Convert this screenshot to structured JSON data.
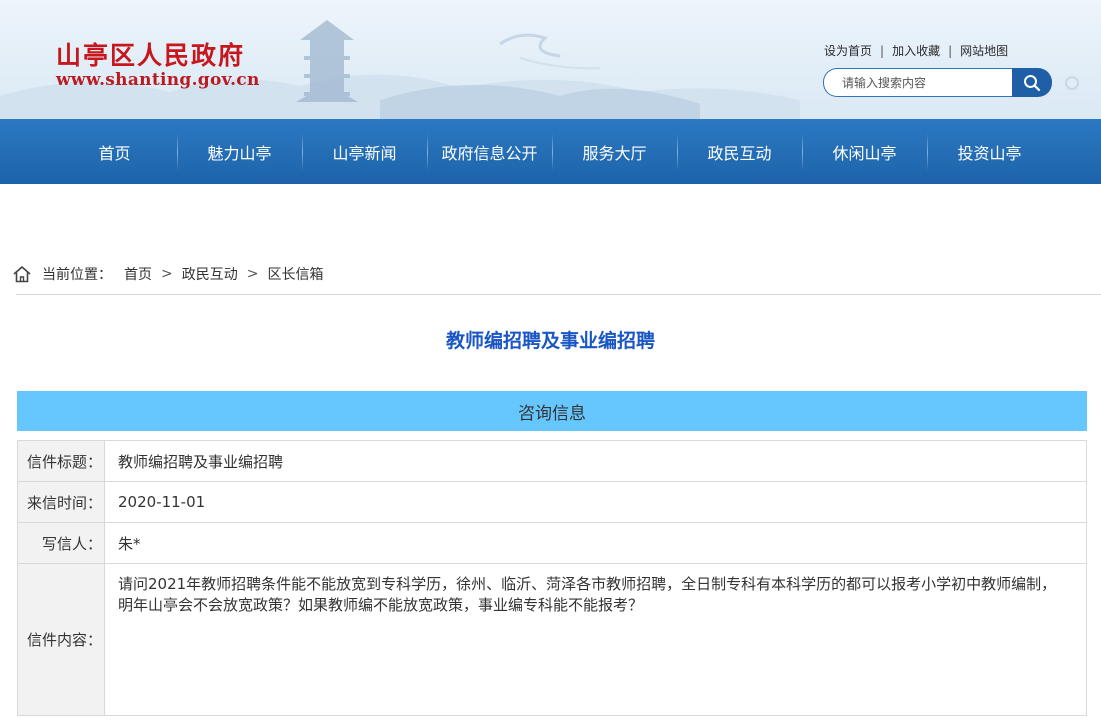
{
  "header": {
    "site_name": "山亭区人民政府",
    "site_url": "www.shanting.gov.cn",
    "links": [
      "设为首页",
      "加入收藏",
      "网站地图"
    ],
    "link_separator": "|",
    "search": {
      "placeholder": "请输入搜索内容",
      "icon": "search-icon"
    }
  },
  "nav": {
    "items": [
      "首页",
      "魅力山亭",
      "山亭新闻",
      "政府信息公开",
      "服务大厅",
      "政民互动",
      "休闲山亭",
      "投资山亭"
    ]
  },
  "breadcrumb": {
    "icon": "home-icon",
    "label": "当前位置：",
    "separator": ">",
    "items": [
      "首页",
      "政民互动",
      "区长信箱"
    ]
  },
  "article": {
    "title": "教师编招聘及事业编招聘",
    "section_header": "咨询信息",
    "fields": [
      {
        "label": "信件标题：",
        "value": "教师编招聘及事业编招聘"
      },
      {
        "label": "来信时间：",
        "value": "2020-11-01"
      },
      {
        "label": "写信人：",
        "value": "朱*"
      },
      {
        "label": "信件内容：",
        "value": "请问2021年教师招聘条件能不能放宽到专科学历，徐州、临沂、菏泽各市教师招聘，全日制专科有本科学历的都可以报考小学初中教师编制，明年山亭会不会放宽政策？如果教师编不能放宽政策，事业编专科能不能报考？"
      }
    ]
  },
  "colors": {
    "nav_bg": "#1d63ab",
    "title": "#1a56c4",
    "section_bar": "#66c7ff",
    "logo_red": "#c8161d"
  }
}
